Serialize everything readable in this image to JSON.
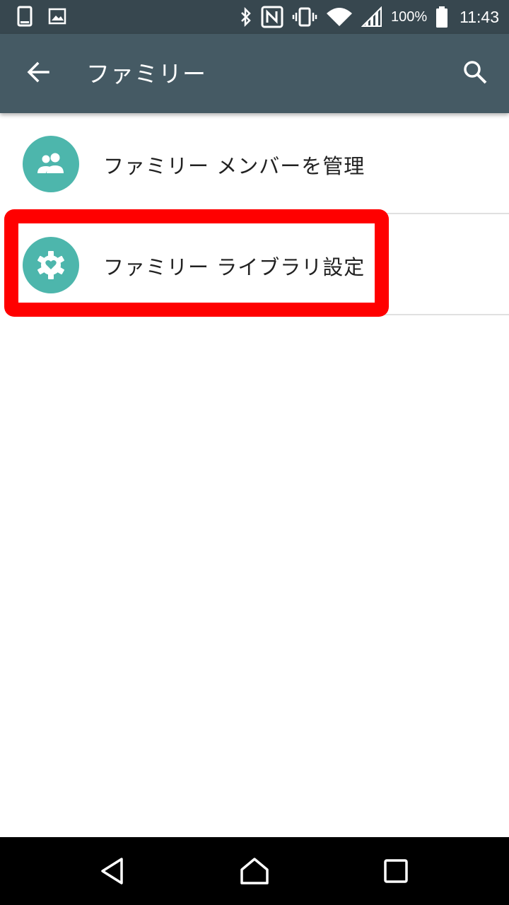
{
  "status_bar": {
    "icons": [
      "phone-icon",
      "image-icon",
      "bluetooth-icon",
      "nfc-icon",
      "vibrate-icon",
      "wifi-icon",
      "signal-icon",
      "battery-icon"
    ],
    "battery_percent": "100%",
    "time": "11:43"
  },
  "app_bar": {
    "title": "ファミリー",
    "back_icon": "arrow-back-icon",
    "search_icon": "search-icon"
  },
  "list": {
    "items": [
      {
        "label": "ファミリー メンバーを管理",
        "icon": "family-members-icon"
      },
      {
        "label": "ファミリー ライブラリ設定",
        "icon": "settings-heart-icon"
      }
    ]
  },
  "highlight": {
    "color": "#ff0000",
    "target": "list.items.1"
  },
  "nav_bar": {
    "icons": [
      "back-triangle-icon",
      "home-icon",
      "recents-icon"
    ]
  },
  "colors": {
    "status_bar": "#37474f",
    "app_bar": "#455a64",
    "avatar": "#4db6ac",
    "text": "#212121"
  }
}
